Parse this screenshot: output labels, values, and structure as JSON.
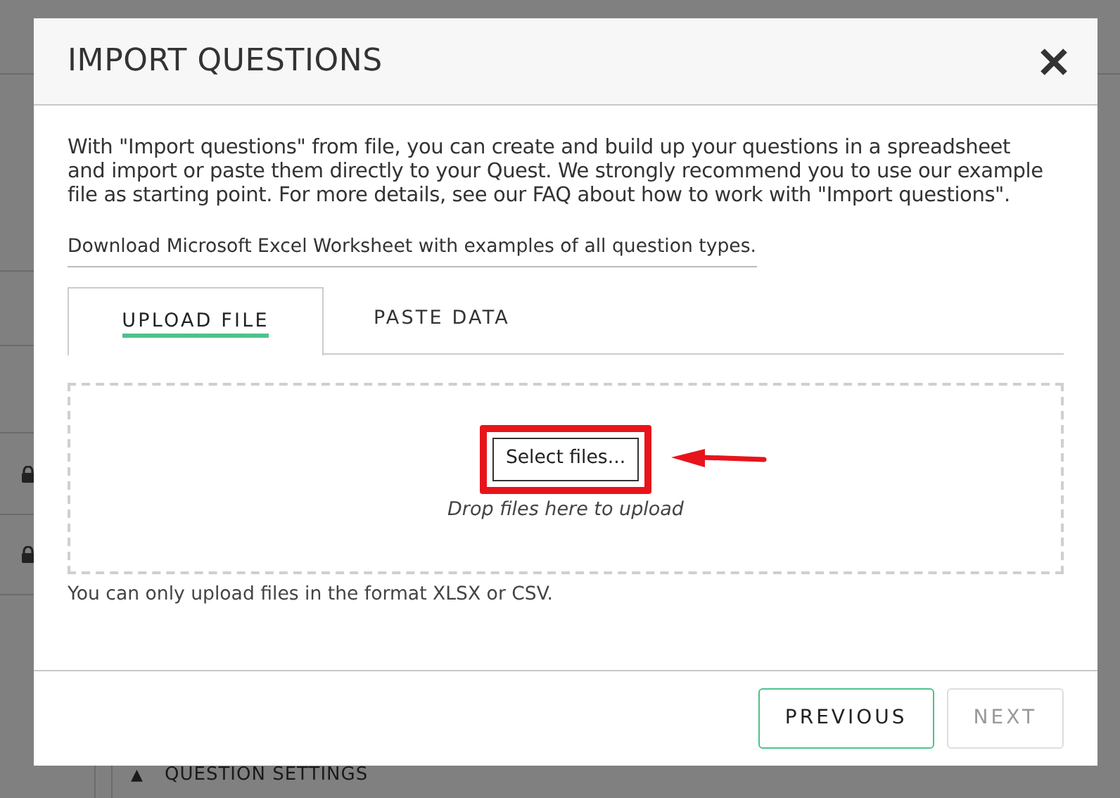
{
  "background": {
    "section_caret": "▲",
    "section_title": "QUESTION SETTINGS"
  },
  "dialog": {
    "title": "IMPORT QUESTIONS",
    "intro": "With \"Import questions\" from file, you can create and build up your questions in a spreadsheet and import or paste them directly to your Quest. We strongly recommend you to use our example file as starting point. For more details, see our FAQ about how to work with \"Import questions\".",
    "download_link": "Download Microsoft Excel Worksheet with examples of all question types.",
    "tabs": [
      {
        "label": "UPLOAD FILE",
        "selected": true
      },
      {
        "label": "PASTE DATA",
        "selected": false
      }
    ],
    "dropzone": {
      "button": "Select files...",
      "hint": "Drop files here to upload",
      "highlighted": true
    },
    "note": "You can only upload files in the format XLSX or CSV.",
    "buttons": [
      {
        "label": "PREVIOUS",
        "disabled": false
      },
      {
        "label": "NEXT",
        "disabled": true
      }
    ]
  }
}
